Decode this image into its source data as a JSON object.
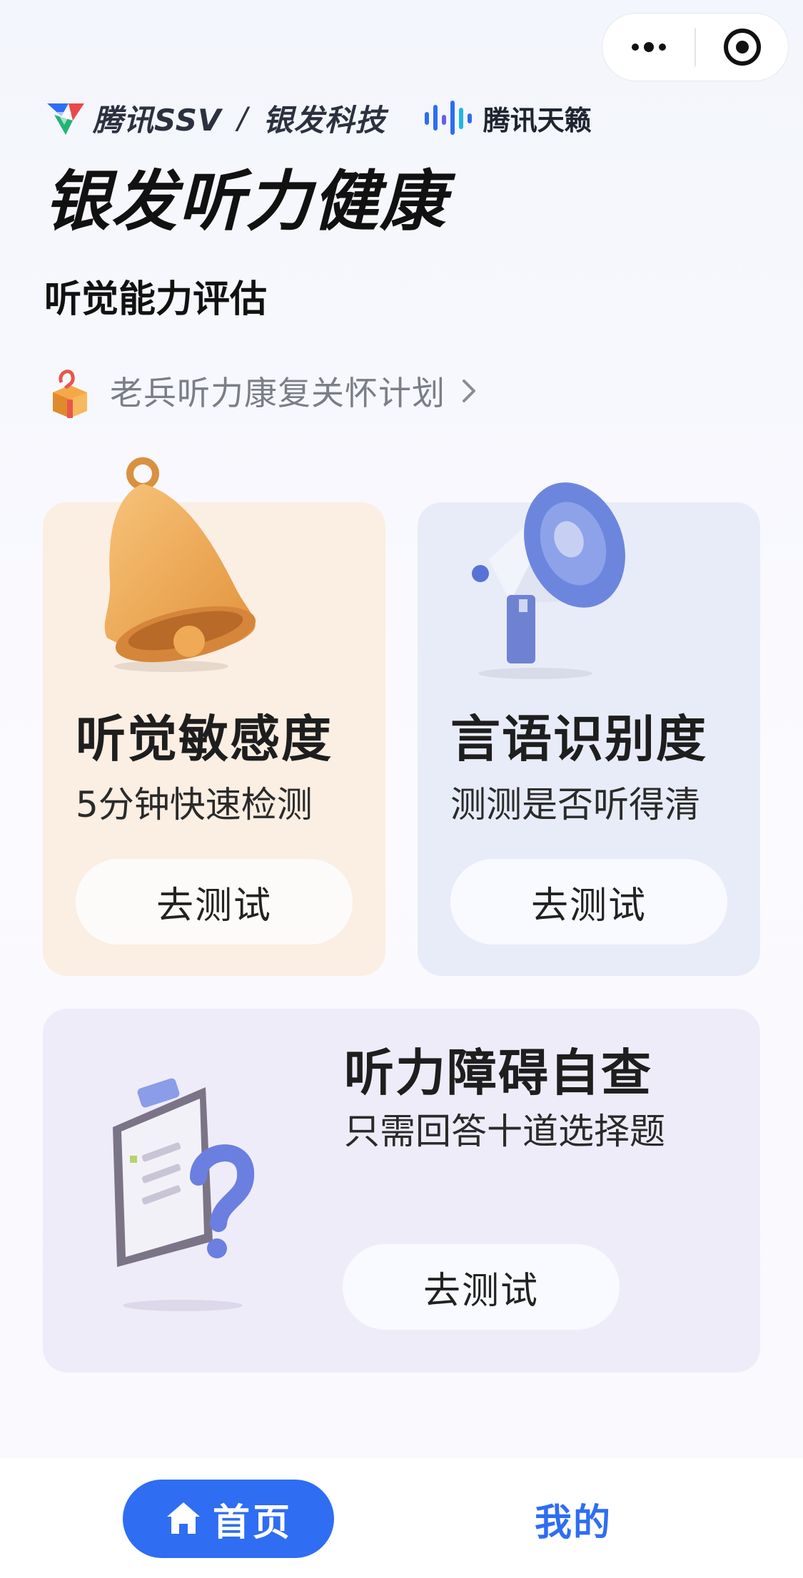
{
  "brand": {
    "ssv_label": "腾讯SSV",
    "separator": "/",
    "yinfa_label": "银发科技",
    "tianlai_label": "腾讯天籁"
  },
  "header": {
    "title": "银发听力健康",
    "subtitle": "听觉能力评估"
  },
  "promo": {
    "label": "老兵听力康复关怀计划",
    "icon": "gift-box-icon"
  },
  "cards": [
    {
      "title": "听觉敏感度",
      "desc": "5分钟快速检测",
      "button": "去测试",
      "icon": "bell-icon",
      "bg": "#fbeee3"
    },
    {
      "title": "言语识别度",
      "desc": "测测是否听得清",
      "button": "去测试",
      "icon": "megaphone-icon",
      "bg": "#e8ecf8"
    },
    {
      "title": "听力障碍自查",
      "desc": "只需回答十道选择题",
      "button": "去测试",
      "icon": "clipboard-question-icon",
      "bg": "#efecf9"
    }
  ],
  "tabbar": {
    "home_label": "首页",
    "mine_label": "我的",
    "accent": "#2f6df2"
  },
  "capsule": {
    "more_icon": "more-dots-icon",
    "close_icon": "target-icon"
  }
}
